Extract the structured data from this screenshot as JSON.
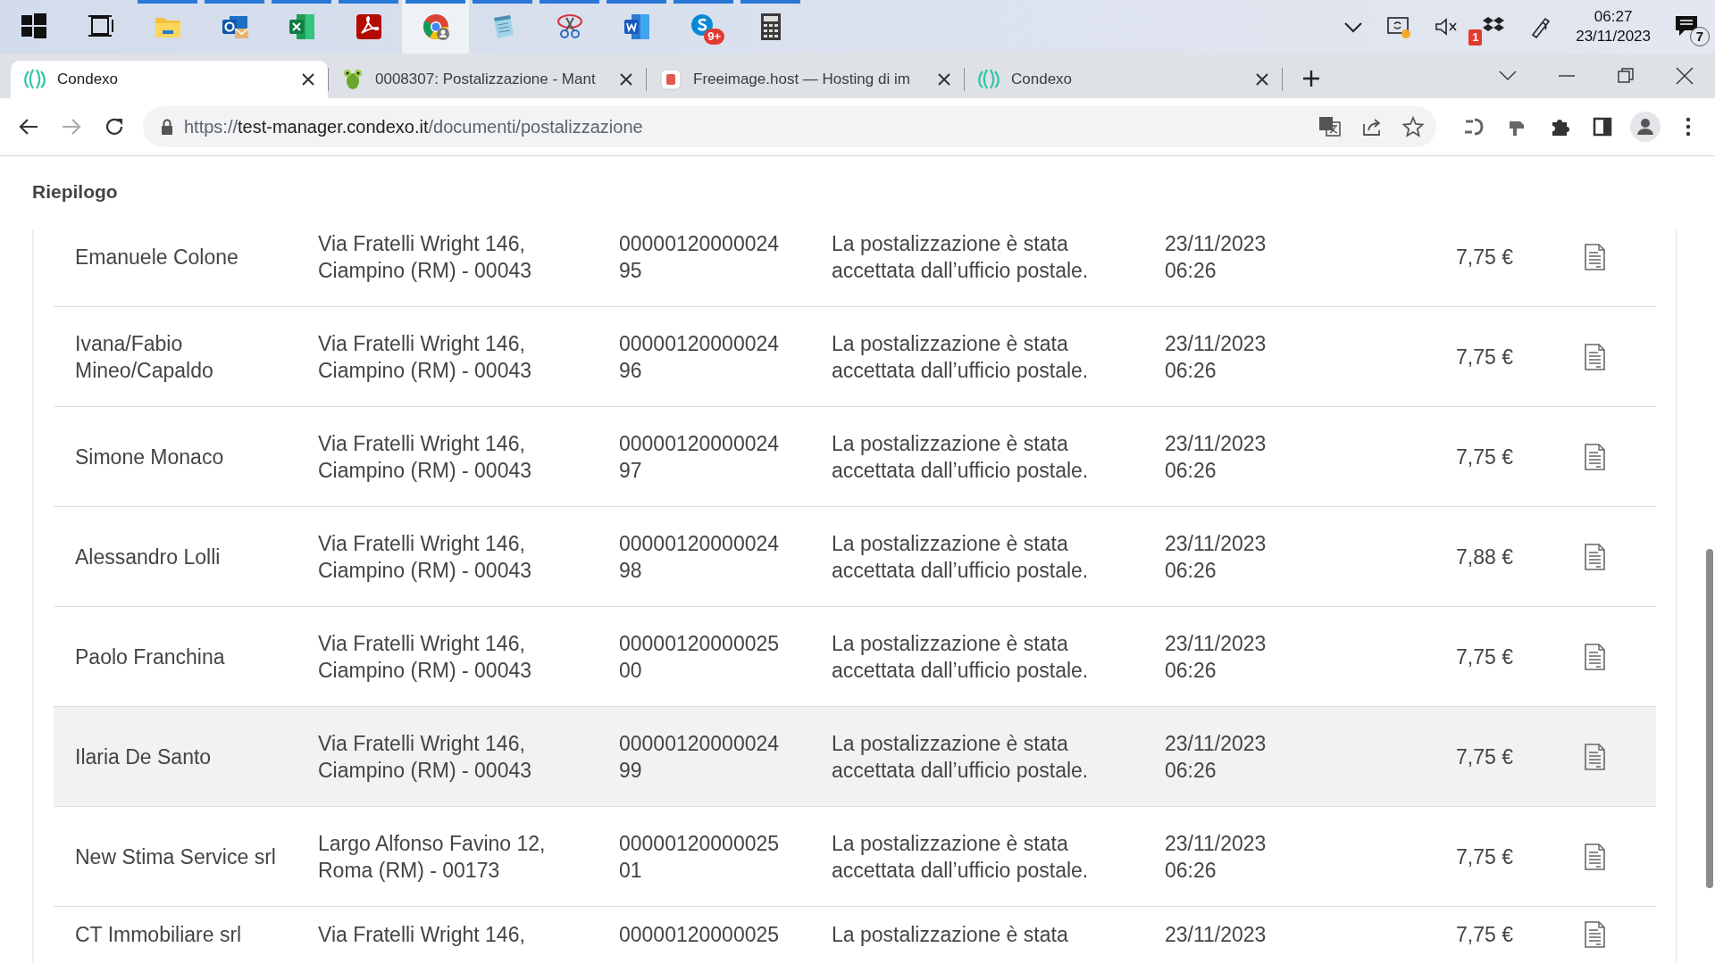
{
  "taskbar": {
    "apps": [
      {
        "selected": false,
        "running": false
      },
      {
        "selected": false,
        "running": false
      },
      {
        "selected": false,
        "running": true
      },
      {
        "selected": false,
        "running": true
      },
      {
        "selected": false,
        "running": true
      },
      {
        "selected": false,
        "running": true
      },
      {
        "selected": true,
        "running": true
      },
      {
        "selected": false,
        "running": true
      },
      {
        "selected": false,
        "running": true
      },
      {
        "selected": false,
        "running": true
      },
      {
        "selected": false,
        "running": true,
        "badge": "9+"
      },
      {
        "selected": false,
        "running": true
      }
    ],
    "tray": {
      "dropbox_badge": "1",
      "time": "06:27",
      "date": "23/11/2023",
      "notifications": "7"
    }
  },
  "browser": {
    "tabs": [
      {
        "title": "Condexo",
        "selected": true
      },
      {
        "title": "0008307: Postalizzazione - Mant",
        "selected": false
      },
      {
        "title": "Freeimage.host — Hosting di im",
        "selected": false
      },
      {
        "title": "Condexo",
        "selected": false
      }
    ],
    "address": {
      "scheme": "https://",
      "host": "test-manager.condexo.it",
      "path": "/documenti/postalizzazione"
    }
  },
  "page": {
    "title": "Riepilogo",
    "rows": [
      {
        "name": "Emanuele Colone",
        "address": "Via Fratelli Wright 146, Ciampino (RM) - 00043",
        "code": "0000012000002495",
        "status": "La postalizzazione è stata accettata dall’ufficio postale.",
        "date": "23/11/2023 06:26",
        "price": "7,75 €",
        "highlighted": false
      },
      {
        "name": "Ivana/Fabio Mineo/Capaldo",
        "address": "Via Fratelli Wright 146, Ciampino (RM) - 00043",
        "code": "0000012000002496",
        "status": "La postalizzazione è stata accettata dall’ufficio postale.",
        "date": "23/11/2023 06:26",
        "price": "7,75 €",
        "highlighted": false
      },
      {
        "name": "Simone Monaco",
        "address": "Via Fratelli Wright 146, Ciampino (RM) - 00043",
        "code": "0000012000002497",
        "status": "La postalizzazione è stata accettata dall’ufficio postale.",
        "date": "23/11/2023 06:26",
        "price": "7,75 €",
        "highlighted": false
      },
      {
        "name": "Alessandro Lolli",
        "address": "Via Fratelli Wright 146, Ciampino (RM) - 00043",
        "code": "0000012000002498",
        "status": "La postalizzazione è stata accettata dall’ufficio postale.",
        "date": "23/11/2023 06:26",
        "price": "7,88 €",
        "highlighted": false
      },
      {
        "name": "Paolo Franchina",
        "address": "Via Fratelli Wright 146, Ciampino (RM) - 00043",
        "code": "0000012000002500",
        "status": "La postalizzazione è stata accettata dall’ufficio postale.",
        "date": "23/11/2023 06:26",
        "price": "7,75 €",
        "highlighted": false
      },
      {
        "name": "Ilaria De Santo",
        "address": "Via Fratelli Wright 146, Ciampino (RM) - 00043",
        "code": "0000012000002499",
        "status": "La postalizzazione è stata accettata dall’ufficio postale.",
        "date": "23/11/2023 06:26",
        "price": "7,75 €",
        "highlighted": true
      },
      {
        "name": "New Stima Service srl",
        "address": "Largo Alfonso Favino 12, Roma (RM) - 00173",
        "code": "0000012000002501",
        "status": "La postalizzazione è stata accettata dall’ufficio postale.",
        "date": "23/11/2023 06:26",
        "price": "7,75 €",
        "highlighted": false
      },
      {
        "name": "CT Immobiliare srl",
        "address": "Via Fratelli Wright 146,",
        "code": "00000120000025",
        "status": "La postalizzazione è stata",
        "date": "23/11/2023",
        "price": "7,75 €",
        "highlighted": false
      }
    ]
  }
}
